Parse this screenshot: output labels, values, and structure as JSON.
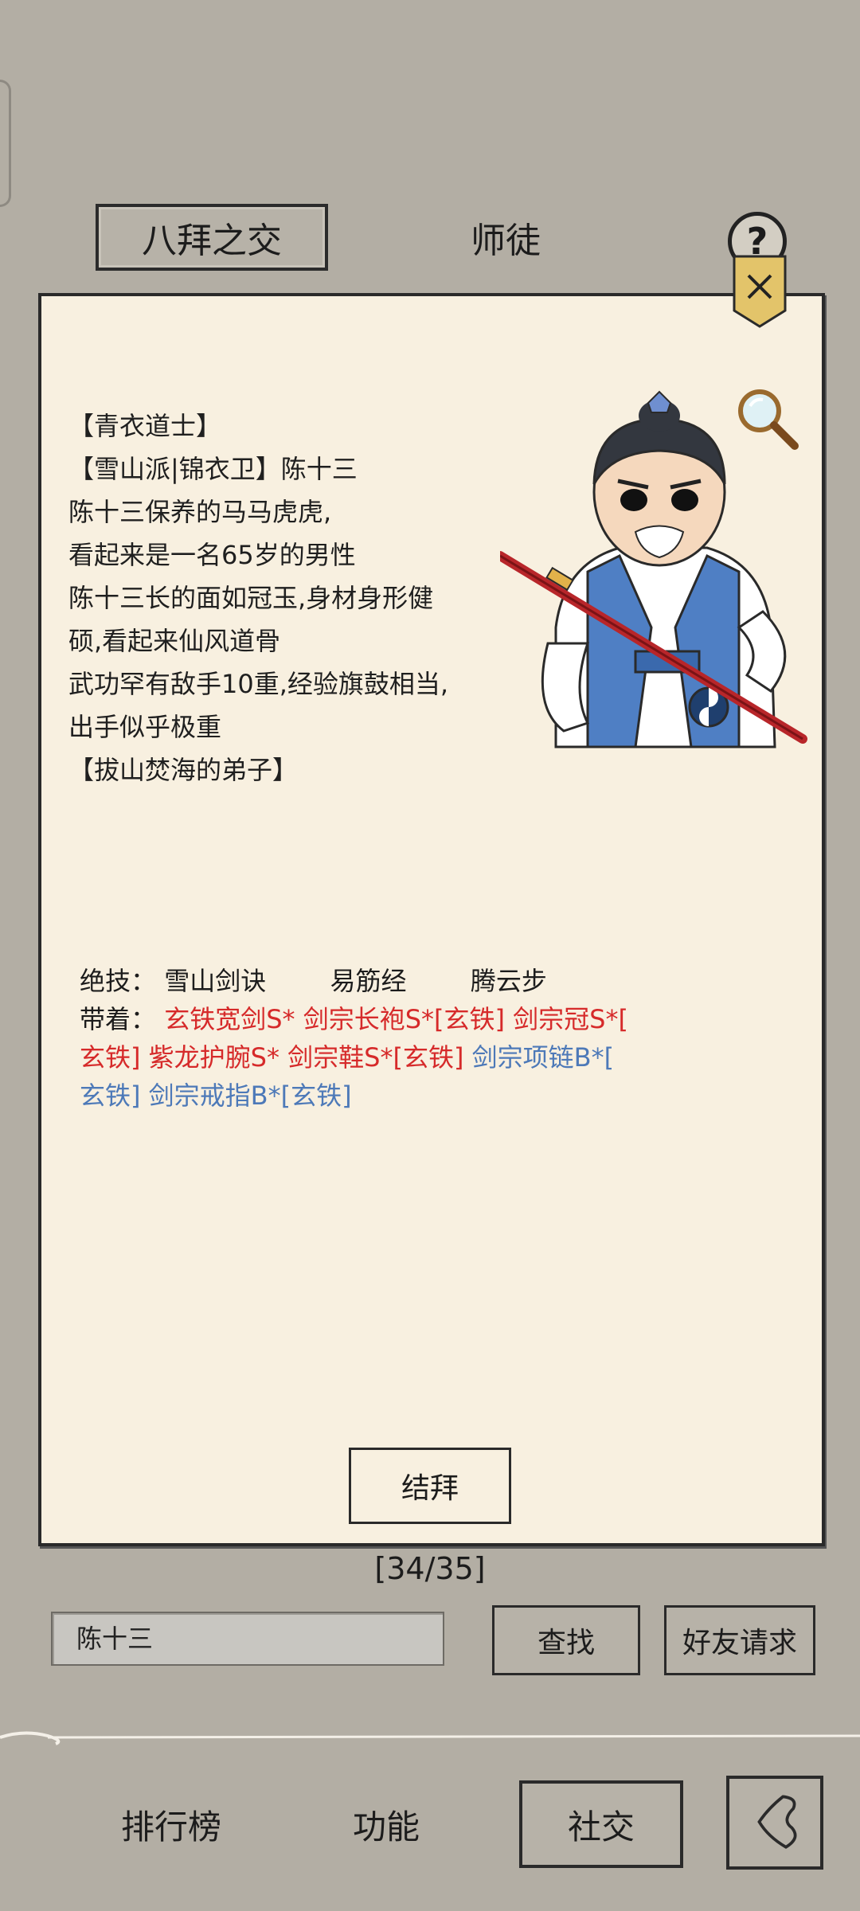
{
  "tabs": [
    {
      "label": "八拜之交",
      "active": true
    },
    {
      "label": "师徒",
      "active": false
    }
  ],
  "help_label": "?",
  "profile": {
    "lines": [
      "【青衣道士】",
      "【雪山派|锦衣卫】陈十三",
      "陈十三保养的马马虎虎,",
      "看起来是一名65岁的男性",
      "陈十三长的面如冠玉,身材身形健",
      "硕,看起来仙风道骨",
      "武功罕有敌手10重,经验旗鼓相当,",
      "出手似乎极重",
      "【拔山焚海的弟子】"
    ]
  },
  "skills": {
    "label": "绝技：",
    "items": [
      "雪山剑诀",
      "易筋经",
      "腾云步"
    ]
  },
  "equipment": {
    "label": "带着：",
    "rows": [
      [
        {
          "text": "玄铁宽剑S*",
          "tier": "red"
        },
        {
          "text": "剑宗长袍S*[玄铁]",
          "tier": "red"
        },
        {
          "text": "剑宗冠S*[",
          "tier": "red"
        }
      ],
      [
        {
          "text": "玄铁]",
          "tier": "red"
        },
        {
          "text": "紫龙护腕S*",
          "tier": "red"
        },
        {
          "text": "剑宗鞋S*[玄铁]",
          "tier": "red"
        },
        {
          "text": "剑宗项链B*[",
          "tier": "blue"
        }
      ],
      [
        {
          "text": "玄铁]",
          "tier": "blue"
        },
        {
          "text": "剑宗戒指B*[玄铁]",
          "tier": "blue"
        }
      ]
    ]
  },
  "bind_button": "结拜",
  "page_counter": "[34/35]",
  "search": {
    "value": "陈十三"
  },
  "find_button": "查找",
  "friend_button": "好友请求",
  "bottom_nav": {
    "rank": "排行榜",
    "function": "功能",
    "social": "社交"
  },
  "colors": {
    "red_tier": "#d62a2a",
    "blue_tier": "#4d79b8",
    "panel_bg": "#f8f0e0",
    "page_bg": "#b3aea4"
  }
}
